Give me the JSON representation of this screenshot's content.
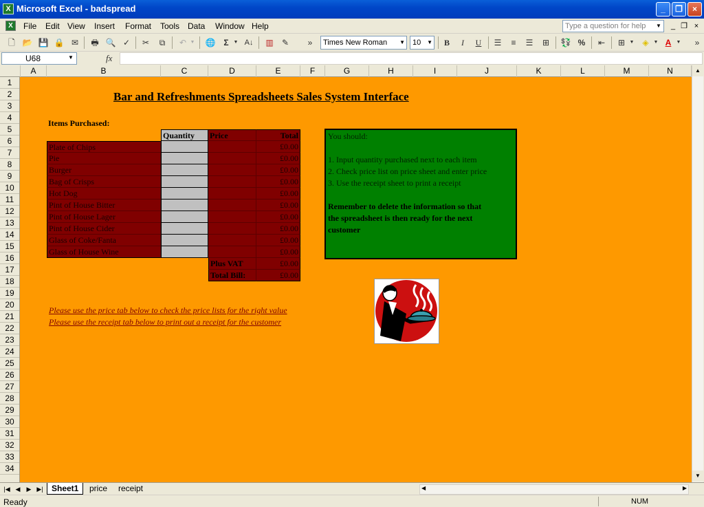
{
  "window": {
    "app_icon": "excel-icon",
    "title": "Microsoft Excel - badspread",
    "controls": [
      "_",
      "❐",
      "×"
    ]
  },
  "menu": {
    "items": [
      "File",
      "Edit",
      "View",
      "Insert",
      "Format",
      "Tools",
      "Data",
      "Window",
      "Help"
    ],
    "help_placeholder": "Type a question for help"
  },
  "toolbar": {
    "font_name": "Times New Roman",
    "font_size": "10",
    "bold": "B",
    "italic": "I",
    "underline": "U",
    "autosum": "Σ",
    "percent": "%"
  },
  "formula_bar": {
    "name_box": "U68",
    "fx_label": "fx",
    "formula": ""
  },
  "columns": [
    "A",
    "B",
    "C",
    "D",
    "E",
    "F",
    "G",
    "H",
    "I",
    "J",
    "K",
    "L",
    "M",
    "N"
  ],
  "rows": [
    "1",
    "2",
    "3",
    "4",
    "5",
    "6",
    "7",
    "8",
    "9",
    "10",
    "11",
    "12",
    "13",
    "14",
    "15",
    "16",
    "17",
    "18",
    "19",
    "20",
    "21",
    "22",
    "23",
    "24",
    "25",
    "26",
    "27",
    "28",
    "29",
    "30",
    "31",
    "32",
    "33",
    "34"
  ],
  "sheet": {
    "heading": "Bar and Refreshments Spreadsheets Sales System Interface",
    "items_purchased_label": "Items Purchased:",
    "col_quantity": "Quantity",
    "col_price": "Price",
    "col_total": "Total",
    "items": [
      {
        "name": "Plate of Chips",
        "total": "£0.00"
      },
      {
        "name": "Pie",
        "total": "£0.00"
      },
      {
        "name": "Burger",
        "total": "£0.00"
      },
      {
        "name": "Bag of Crisps",
        "total": "£0.00"
      },
      {
        "name": "Hot Dog",
        "total": "£0.00"
      },
      {
        "name": "Pint of House Bitter",
        "total": "£0.00"
      },
      {
        "name": "Pint of House Lager",
        "total": "£0.00"
      },
      {
        "name": "Pint of House Cider",
        "total": "£0.00"
      },
      {
        "name": "Glass of Coke/Fanta",
        "total": "£0.00"
      },
      {
        "name": "Glass of House Wine",
        "total": "£0.00"
      }
    ],
    "plus_vat_label": "Plus VAT",
    "plus_vat_value": "£0.00",
    "total_bill_label": "Total Bill:",
    "total_bill_value": "£0.00",
    "link_price": "Please use the price tab below to check the price lists for the right value",
    "link_receipt": "Please use the receipt tab below to print out a receipt for the customer",
    "instructions": {
      "line1": "You should:",
      "line2": "1.  Input quantity purchased next to each item",
      "line3": "2.  Check price list on price sheet and enter price",
      "line4": "3.  Use the receipt sheet to print a receipt",
      "line5": "Remember to delete the information so that",
      "line6": "the spreadsheet is then ready for the next",
      "line7": "customer"
    },
    "image": "waiter-serving-icon"
  },
  "tabs": [
    "Sheet1",
    "price",
    "receipt"
  ],
  "active_tab": "Sheet1",
  "status": {
    "ready": "Ready",
    "num": "NUM"
  },
  "colors": {
    "sheet_bg": "#fe9900",
    "table_fill": "#800000",
    "input_fill": "#c0c0c0",
    "instruction_fill": "#008000"
  }
}
